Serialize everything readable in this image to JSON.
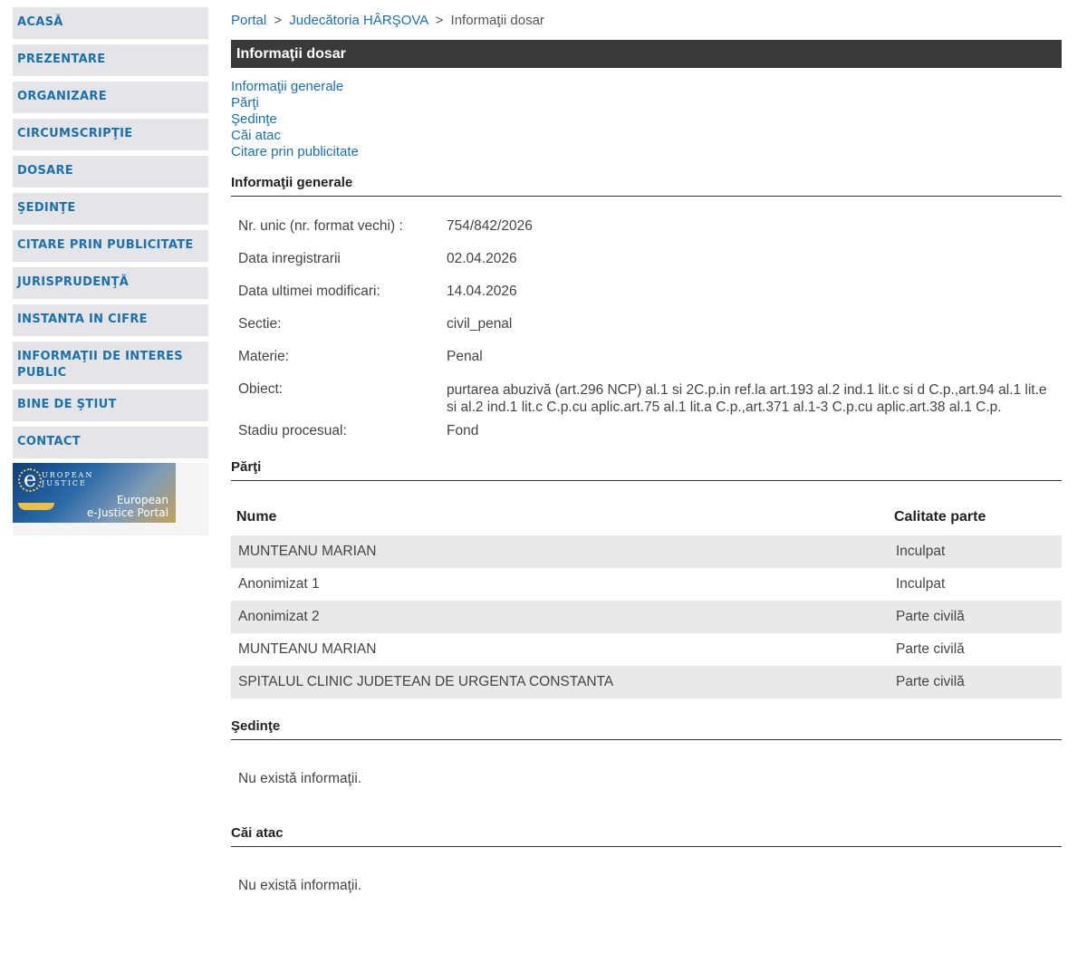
{
  "sidebar": {
    "items": [
      {
        "label": "ACASĂ"
      },
      {
        "label": "PREZENTARE"
      },
      {
        "label": "ORGANIZARE"
      },
      {
        "label": "CIRCUMSCRIPŢIE"
      },
      {
        "label": "DOSARE"
      },
      {
        "label": "ŞEDINŢE"
      },
      {
        "label": "CITARE PRIN PUBLICITATE"
      },
      {
        "label": "JURISPRUDENŢĂ"
      },
      {
        "label": "INSTANTA IN CIFRE"
      },
      {
        "label": "INFORMAŢII DE INTERES PUBLIC"
      },
      {
        "label": "BINE DE ŞTIUT"
      },
      {
        "label": "CONTACT"
      }
    ],
    "ejustice": {
      "eur_line1": "UROPEAN",
      "eur_line2": "JUSTICE",
      "e_letter": "e",
      "title1": "European",
      "title2": "e-Justice Portal"
    }
  },
  "breadcrumb": {
    "portal": "Portal",
    "court": "Judecătoria HÂRŞOVA",
    "current": "Informaţii dosar",
    "sep": ">"
  },
  "title": "Informaţii dosar",
  "anchors": [
    "Informaţii generale",
    "Părţi",
    "Şedinţe",
    "Căi atac",
    "Citare prin publicitate"
  ],
  "general": {
    "heading": "Informaţii generale",
    "rows": [
      {
        "label": "Nr. unic (nr. format vechi) :",
        "value": "754/842/2026"
      },
      {
        "label": "Data inregistrarii",
        "value": "02.04.2026"
      },
      {
        "label": "Data ultimei modificari:",
        "value": "14.04.2026"
      },
      {
        "label": "Sectie:",
        "value": "civil_penal"
      },
      {
        "label": "Materie:",
        "value": "Penal"
      },
      {
        "label": "Obiect:",
        "value": "purtarea abuzivă (art.296 NCP) al.1 si 2C.p.in ref.la art.193 al.2 ind.1 lit.c si d C.p.,art.94 al.1 lit.e si al.2 ind.1 lit.c C.p.cu aplic.art.75 al.1 lit.a C.p.,art.371 al.1-3 C.p.cu aplic.art.38 al.1 C.p."
      },
      {
        "label": "Stadiu procesual:",
        "value": "Fond"
      }
    ]
  },
  "parti": {
    "heading": "Părţi",
    "col_name": "Nume",
    "col_role": "Calitate parte",
    "rows": [
      {
        "name": "MUNTEANU MARIAN",
        "role": "Inculpat"
      },
      {
        "name": "Anonimizat 1",
        "role": "Inculpat"
      },
      {
        "name": "Anonimizat 2",
        "role": "Parte civilă"
      },
      {
        "name": "MUNTEANU MARIAN",
        "role": "Parte civilă"
      },
      {
        "name": "SPITALUL CLINIC JUDETEAN DE URGENTA CONSTANTA",
        "role": "Parte civilă"
      }
    ]
  },
  "sedinte": {
    "heading": "Şedinţe",
    "empty": "Nu există informaţii."
  },
  "cai_atac": {
    "heading": "Căi atac",
    "empty": "Nu există informaţii."
  },
  "colors": {
    "link": "#1f6fa8",
    "title_bar": "#3a3a3a",
    "sidebar_bg": "#e3e5e8",
    "row_alt": "#e8e9eb"
  }
}
